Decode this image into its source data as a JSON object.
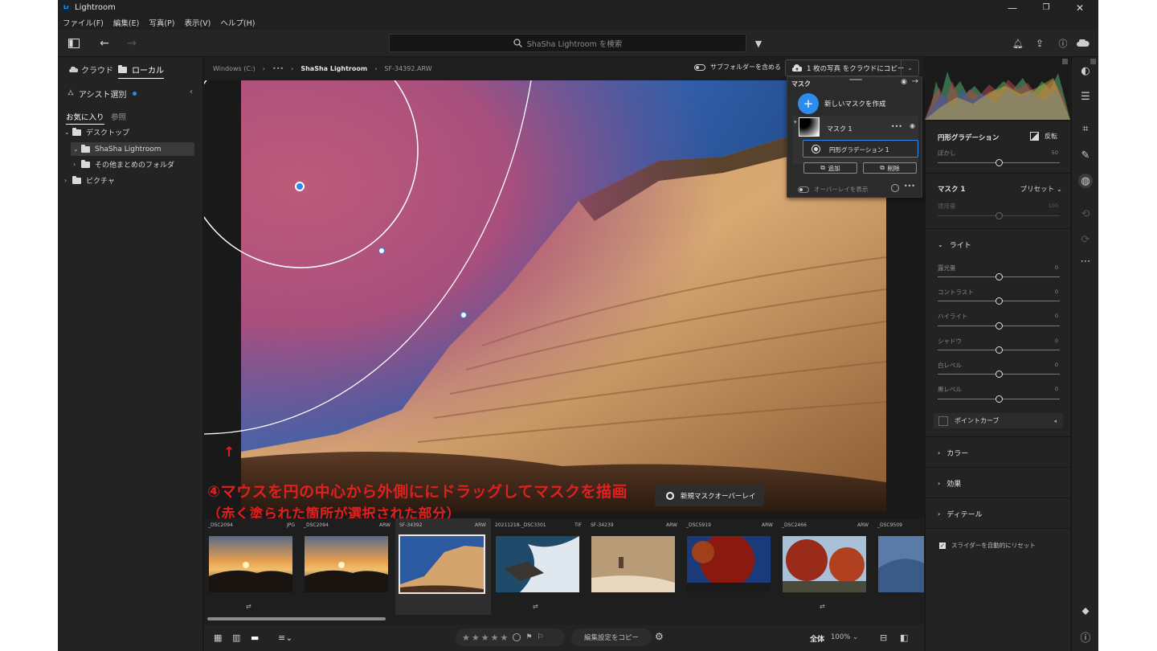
{
  "titlebar": {
    "app_name": "Lightroom",
    "logo": "Lr"
  },
  "menu": [
    "ファイル(F)",
    "編集(E)",
    "写真(P)",
    "表示(V)",
    "ヘルプ(H)"
  ],
  "search": {
    "placeholder": "ShaSha Lightroom を検索"
  },
  "left_panel": {
    "tabs": [
      "クラウド",
      "ローカル"
    ],
    "assist": "アシスト選別",
    "subtabs": [
      "お気に入り",
      "参照"
    ],
    "tree": [
      {
        "label": "デスクトップ"
      },
      {
        "label": "ShaSha Lightroom"
      },
      {
        "label": "その他まとめのフォルダ"
      },
      {
        "label": "ピクチャ"
      }
    ]
  },
  "breadcrumb": {
    "drive": "Windows (C:)",
    "ellipsis": "•••",
    "folder": "ShaSha Lightroom",
    "file": "SF-34392.ARW"
  },
  "subfolder_toggle": "サブフォルダーを含める",
  "cloud_copy": "1 枚の写真 をクラウドにコピー",
  "mask_panel": {
    "title": "マスク",
    "create": "新しいマスクを作成",
    "mask_name": "マスク 1",
    "component": "円形グラデーション 1",
    "add": "追加",
    "delete": "削除",
    "overlay": "オーバーレイを表示"
  },
  "annotation": {
    "arrow": "↑",
    "line1": "④マウスを円の中心から外側ににドラッグしてマスクを描画",
    "line2": "（赤く塗られた箇所が選択された部分）"
  },
  "new_mask_overlay": "新規マスクオーバーレイ",
  "right_panel": {
    "tool_title": "円形グラデーション",
    "invert": "反転",
    "feather_label": "ぼかし",
    "feather_value": "50",
    "mask_title": "マスク 1",
    "preset": "プリセット",
    "amount_label": "適用量",
    "amount_value": "100",
    "light_section": "ライト",
    "sliders": [
      {
        "label": "露光量",
        "value": "0"
      },
      {
        "label": "コントラスト",
        "value": "0"
      },
      {
        "label": "ハイライト",
        "value": "0"
      },
      {
        "label": "シャドウ",
        "value": "0"
      },
      {
        "label": "白レベル",
        "value": "0"
      },
      {
        "label": "黒レベル",
        "value": "0"
      }
    ],
    "point_curve": "ポイントカーブ",
    "sections": [
      "カラー",
      "効果",
      "ディテール"
    ],
    "auto_reset": "スライダーを自動的にリセット"
  },
  "filmstrip": [
    {
      "name": "_DSC2094",
      "type": "JPG",
      "sync": "⇄"
    },
    {
      "name": "_DSC2094",
      "type": "ARW",
      "sync": ""
    },
    {
      "name": "SF-34392",
      "type": "ARW",
      "sync": ""
    },
    {
      "name": "20211218-_DSC3301",
      "type": "TIF",
      "sync": "⇄"
    },
    {
      "name": "SF-34239",
      "type": "ARW",
      "sync": ""
    },
    {
      "name": "_DSC5919",
      "type": "ARW",
      "sync": ""
    },
    {
      "name": "_DSC2466",
      "type": "ARW",
      "sync": "⇄"
    },
    {
      "name": "_DSC9509",
      "type": "",
      "sync": ""
    }
  ],
  "bottom": {
    "stars": "★★★★★",
    "copy_settings": "編集設定をコピー",
    "fit": "全体",
    "zoom": "100%"
  },
  "colors": {
    "accent": "#2d8ceb",
    "annotation": "#e02020"
  }
}
